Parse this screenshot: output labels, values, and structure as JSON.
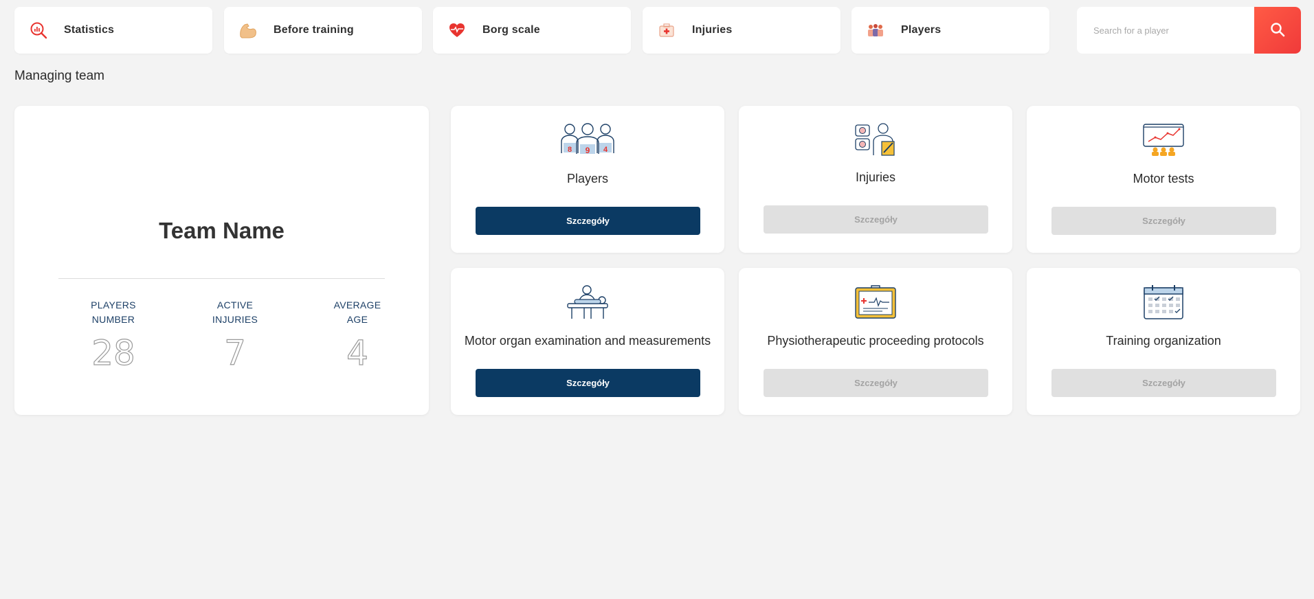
{
  "nav": {
    "items": [
      {
        "label": "Statistics",
        "icon": "statistics-magnifier-icon"
      },
      {
        "label": "Before training",
        "icon": "arm-muscle-icon"
      },
      {
        "label": "Borg scale",
        "icon": "heart-pulse-icon"
      },
      {
        "label": "Injuries",
        "icon": "medical-kit-icon"
      },
      {
        "label": "Players",
        "icon": "players-group-icon"
      }
    ]
  },
  "search": {
    "placeholder": "Search for a player",
    "value": "",
    "button_icon": "search-icon"
  },
  "section_title": "Managing team",
  "team": {
    "name": "Team Name",
    "stats": [
      {
        "label_line1": "PLAYERS",
        "label_line2": "NUMBER",
        "value": "28"
      },
      {
        "label_line1": "ACTIVE",
        "label_line2": "INJURIES",
        "value": "7"
      },
      {
        "label_line1": "AVERAGE",
        "label_line2": "AGE",
        "value": "4"
      }
    ]
  },
  "modules": [
    {
      "title": "Players",
      "button": "Szczegóły",
      "enabled": true,
      "icon": "players-jerseys-icon",
      "jersey_numbers": [
        "8",
        "9",
        "4"
      ]
    },
    {
      "title": "Injuries",
      "button": "Szczegóły",
      "enabled": false,
      "icon": "doctor-injuries-icon"
    },
    {
      "title": "Motor tests",
      "button": "Szczegóły",
      "enabled": false,
      "icon": "presentation-chart-icon"
    },
    {
      "title": "Motor organ examination and measurements",
      "button": "Szczegóły",
      "enabled": true,
      "icon": "examination-table-icon"
    },
    {
      "title": "Physiotherapeutic proceeding protocols",
      "button": "Szczegóły",
      "enabled": false,
      "icon": "clipboard-ecg-icon"
    },
    {
      "title": "Training organization",
      "button": "Szczegóły",
      "enabled": false,
      "icon": "calendar-icon"
    }
  ],
  "colors": {
    "accent_red": "#f03a3a",
    "primary_navy": "#0b3a63",
    "disabled_gray": "#e0e0e0",
    "background": "#f3f3f3"
  }
}
